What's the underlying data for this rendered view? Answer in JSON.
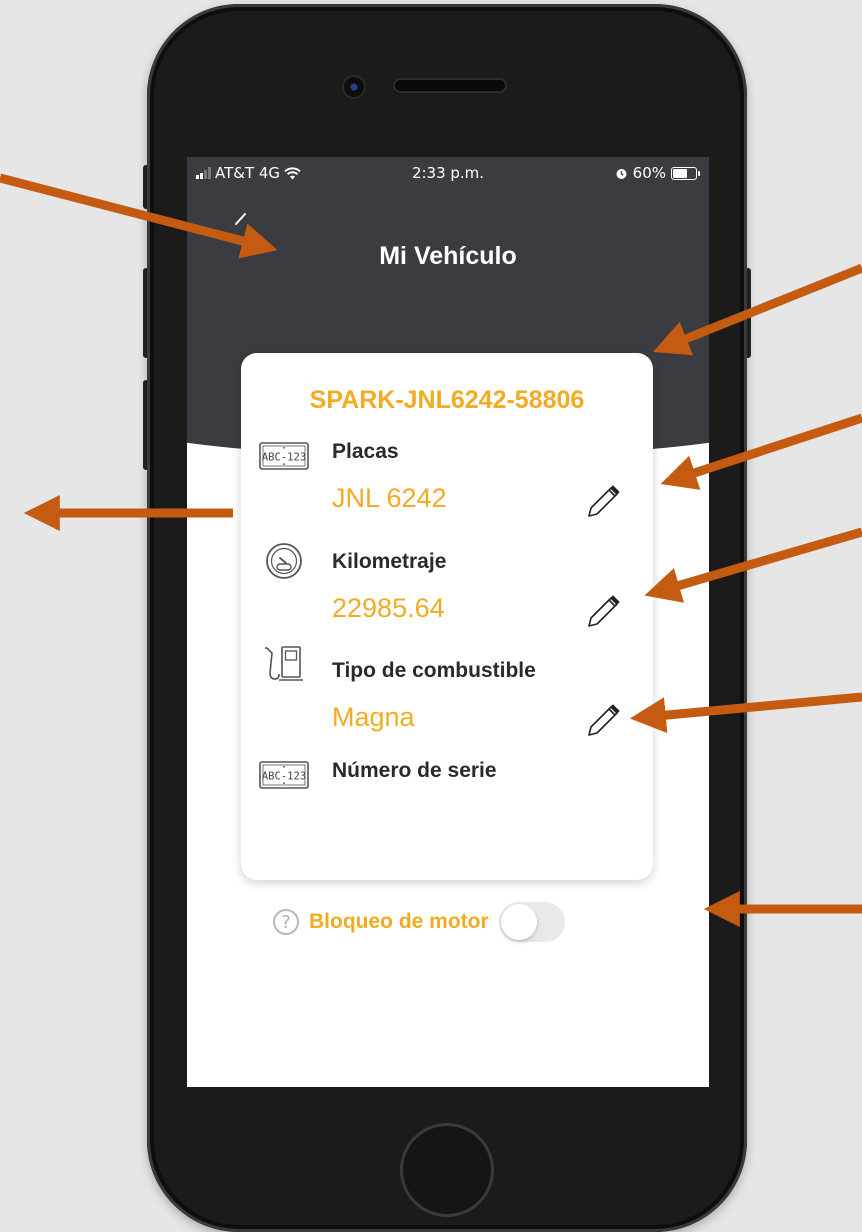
{
  "status_bar": {
    "carrier": "AT&T 4G",
    "time": "2:33 p.m.",
    "battery_percent": "60%"
  },
  "screen": {
    "title": "Mi Vehículo"
  },
  "vehicle": {
    "id": "SPARK-JNL6242-58806",
    "fields": [
      {
        "label": "Placas",
        "value": "JNL 6242",
        "icon": "license-plate-icon",
        "editable": true
      },
      {
        "label": "Kilometraje",
        "value": "22985.64",
        "icon": "odometer-icon",
        "editable": true
      },
      {
        "label": "Tipo de combustible",
        "value": "Magna",
        "icon": "fuel-pump-icon",
        "editable": true
      },
      {
        "label": "Número de serie",
        "value": "",
        "icon": "license-plate-icon",
        "editable": false
      }
    ],
    "plate_icon_text": "ABC-123"
  },
  "engine_lock": {
    "label": "Bloqueo de motor",
    "enabled": false
  },
  "colors": {
    "accent": "#f2ab22",
    "header": "#3b3c41",
    "annotation_arrow": "#c55a11"
  }
}
